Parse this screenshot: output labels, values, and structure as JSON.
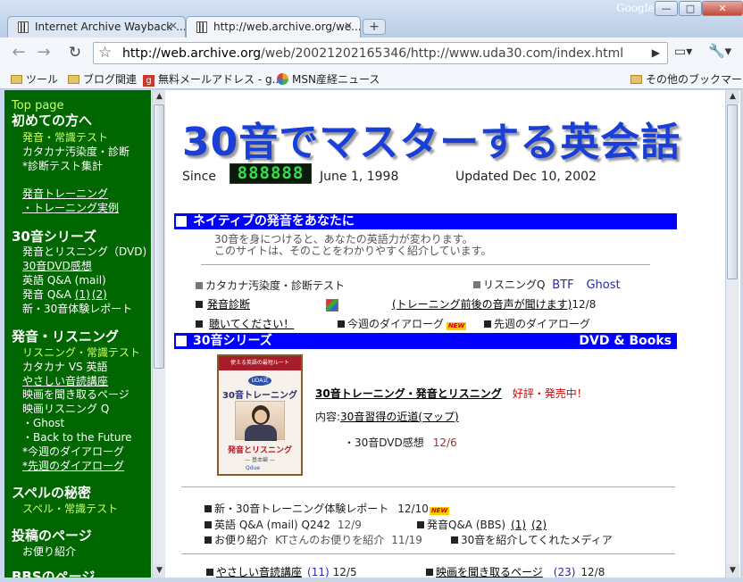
{
  "browser": {
    "brand": "Google",
    "tabs": [
      {
        "label": "Internet Archive Wayback ..."
      },
      {
        "label": "http://web.archive.org/we..."
      }
    ],
    "url_host": "http://web.archive.org",
    "url_path": "/web/20021202165346/http://www.uda30.com/index.html",
    "bookmarks": [
      "ツール",
      "ブログ関連",
      "無料メールアドレス - g...",
      "MSN産経ニュース",
      "その他のブックマーク"
    ]
  },
  "sidebar": {
    "top_page": "Top page",
    "beginners": {
      "heading": "初めての方へ",
      "items": [
        "発音・常識テスト",
        "カタカナ汚染度・診断",
        "*診断テスト集計",
        "発音トレーニング",
        "・トレーニング実例"
      ]
    },
    "series": {
      "heading": "30音シリーズ",
      "items": [
        "発音とリスニング（DVD)",
        "30音DVD感想",
        "英語 Q&A (mail)",
        "発音 Q&A",
        "(1)",
        "(2)",
        "新・30音体験レポート"
      ]
    },
    "listening": {
      "heading": "発音・リスニング",
      "items": [
        "リスニング・常識テスト",
        "カタカナ VS 英語",
        "やさしい音読講座",
        "映画を聞き取るページ",
        "映画リスニング Q",
        "・Ghost",
        "・Back to the Future",
        "*今週のダイアローグ",
        "*先週のダイアローグ"
      ]
    },
    "spell": {
      "heading": "スペルの秘密",
      "items": [
        "スペル・常識テスト"
      ]
    },
    "posts": {
      "heading": "投稿のページ",
      "items": [
        "お便り紹介"
      ]
    },
    "bbs": {
      "heading": "BBSのページ"
    }
  },
  "main": {
    "title": "30音でマスターする英会話",
    "since_label": "Since",
    "counter": "888888",
    "since_date": "June 1, 1998",
    "updated": "Updated Dec 10, 2002",
    "native": {
      "heading": "ネイティブの発音をあなたに",
      "lines": [
        "30音を身につけると、あなたの英語力が変わります。",
        "このサイトは、そのことをわかりやすく紹介しています。"
      ]
    },
    "links1": {
      "katakana_test": "カタカナ汚染度・診断テスト",
      "listening_q": "リスニングQ",
      "btf": "BTF",
      "ghost": "Ghost",
      "pron_diag": "発音診断",
      "training_voice": "(トレーニング前後の音声が聞けます)",
      "training_date": "12/8",
      "listen_please": "聴いてください！",
      "this_week": "今週のダイアローグ",
      "last_week": "先週のダイアローグ",
      "new_badge": "NEW"
    },
    "series": {
      "heading": "30音シリーズ",
      "right": "DVD & Books",
      "product_link": "30音トレーニング・発音とリスニング",
      "product_status": "好評・発売中！",
      "content_label": "内容:",
      "content_link": "30音習得の近道(マップ)",
      "dvd_review": "・30音DVD感想",
      "dvd_review_date": "12/6"
    },
    "dvd_cover": {
      "top": "使える英語の最短ルート",
      "brand": "UDA式",
      "title": "30音トレーニング",
      "subtitle": "発音とリスニング",
      "edition": "― 基本編 ―",
      "logo": "Qdue"
    },
    "news": {
      "report": "新・30音トレーニング体験レポート",
      "report_date": "12/10",
      "qa_mail": "英語 Q&A (mail) Q242",
      "qa_mail_date": "12/9",
      "qa_bbs": "発音Q&A (BBS)",
      "qa_bbs_1": "(1)",
      "qa_bbs_2": "(2)",
      "letters": "お便り紹介",
      "letters_note": "KTさんのお便りを紹介",
      "letters_date": "11/19",
      "media": "30音を紹介してくれたメディア",
      "reading_link": "やさしい音読講座",
      "reading_count": "(11)",
      "reading_date": "12/5",
      "movie_link": "映画を聞き取るページ",
      "movie_count": "(23)",
      "movie_date": "12/8"
    }
  }
}
